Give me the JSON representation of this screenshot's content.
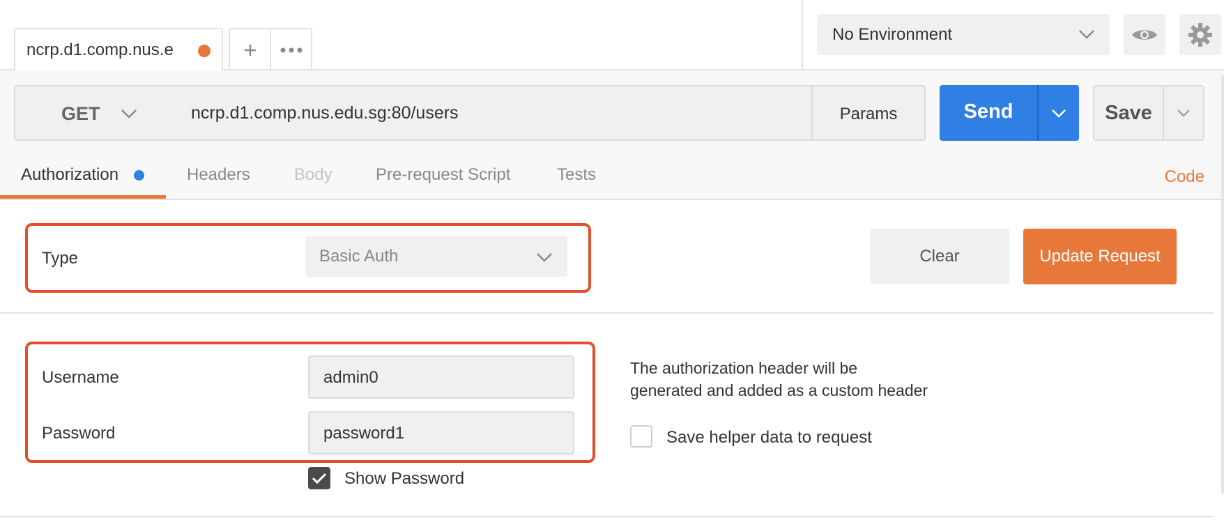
{
  "tabs": {
    "active_label": "ncrp.d1.comp.nus.e",
    "add_icon": "plus-icon",
    "more_icon": "ellipsis-icon"
  },
  "environment": {
    "selected": "No Environment"
  },
  "request": {
    "method": "GET",
    "url": "ncrp.d1.comp.nus.edu.sg:80/users",
    "params_label": "Params",
    "send_label": "Send",
    "save_label": "Save"
  },
  "subtabs": {
    "authorization": "Authorization",
    "headers": "Headers",
    "body": "Body",
    "prerequest": "Pre-request Script",
    "tests": "Tests",
    "code": "Code"
  },
  "auth": {
    "type_label": "Type",
    "type_value": "Basic Auth",
    "clear_label": "Clear",
    "update_label": "Update Request",
    "username_label": "Username",
    "username_value": "admin0",
    "password_label": "Password",
    "password_value": "password1",
    "show_password_label": "Show Password",
    "show_password_checked": true,
    "help_line1": "The authorization header will be",
    "help_line2": "generated and added as a custom header",
    "save_helper_label": "Save helper data to request",
    "save_helper_checked": false
  },
  "colors": {
    "accent_orange": "#e8773a",
    "send_blue": "#2f7fe4",
    "highlight_red": "#e0502d"
  }
}
